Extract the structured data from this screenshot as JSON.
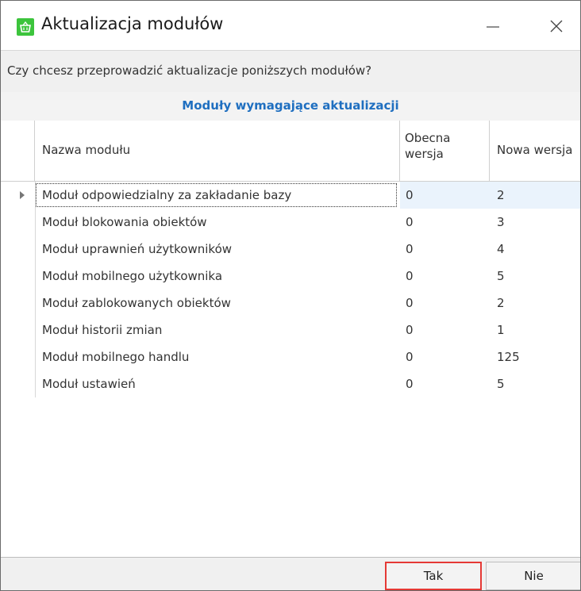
{
  "window": {
    "title": "Aktualizacja modułów",
    "icon": "basket-icon",
    "accent": "#3cc43c"
  },
  "prompt": "Czy chcesz przeprowadzić aktualizacje poniższych modułów?",
  "grid": {
    "group_title": "Moduły wymagające aktualizacji",
    "group_title_color": "#1f6fc0",
    "columns": {
      "name": "Nazwa modułu",
      "current": "Obecna wersja",
      "new": "Nowa wersja"
    },
    "rows": [
      {
        "name": "Moduł odpowiedzialny za zakładanie bazy",
        "current": "0",
        "new": "2"
      },
      {
        "name": "Moduł blokowania obiektów",
        "current": "0",
        "new": "3"
      },
      {
        "name": "Moduł uprawnień użytkowników",
        "current": "0",
        "new": "4"
      },
      {
        "name": "Moduł mobilnego użytkownika",
        "current": "0",
        "new": "5"
      },
      {
        "name": "Moduł zablokowanych obiektów",
        "current": "0",
        "new": "2"
      },
      {
        "name": "Moduł historii zmian",
        "current": "0",
        "new": "1"
      },
      {
        "name": "Moduł mobilnego handlu",
        "current": "0",
        "new": "125"
      },
      {
        "name": "Moduł ustawień",
        "current": "0",
        "new": "5"
      }
    ]
  },
  "buttons": {
    "yes": "Tak",
    "no": "Nie",
    "highlight_color": "#e53935"
  }
}
